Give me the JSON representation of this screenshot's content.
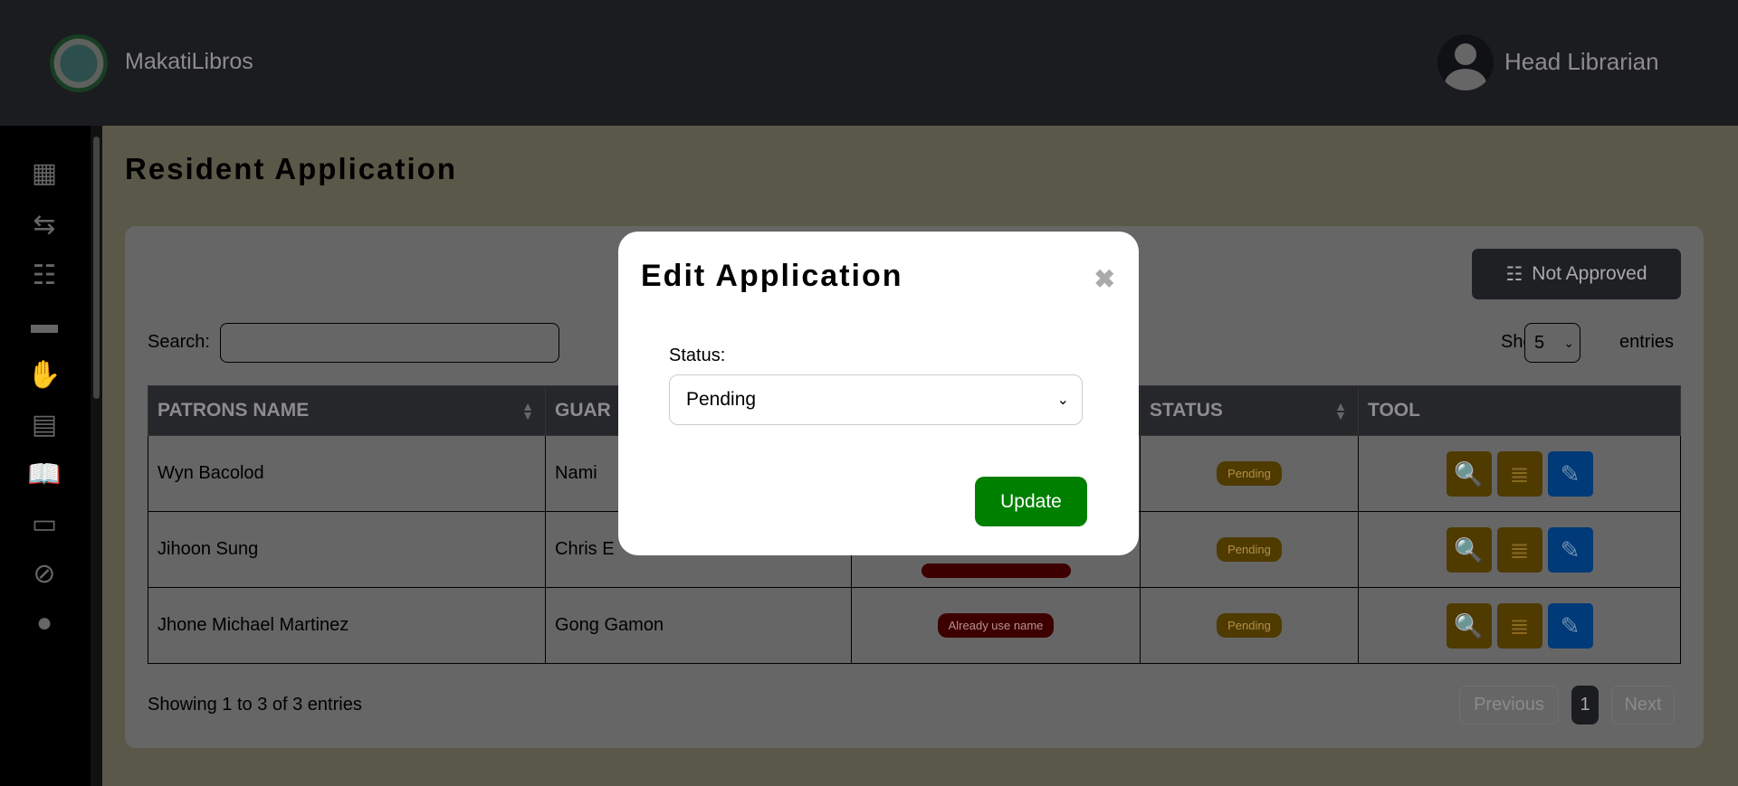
{
  "header": {
    "brand": "MakatiLibros",
    "logo_text": "MAKATI CITY LIBRARY 1954",
    "user": "Head Librarian"
  },
  "sidebar": {
    "items": [
      {
        "icon": "dashboard-icon"
      },
      {
        "icon": "transfer-icon"
      },
      {
        "icon": "list-check-icon"
      },
      {
        "icon": "book-icon"
      },
      {
        "icon": "hand-book-icon"
      },
      {
        "icon": "document-icon"
      },
      {
        "icon": "reader-icon"
      },
      {
        "icon": "id-card-check-icon"
      },
      {
        "icon": "user-blocked-icon"
      },
      {
        "icon": "user-icon"
      }
    ]
  },
  "page": {
    "title": "Resident Application"
  },
  "toolbar": {
    "not_approved": "Not Approved",
    "search_label": "Search:",
    "search_value": "",
    "show_label": "Show",
    "show_value": "5",
    "entries_label": "entries"
  },
  "table": {
    "columns": [
      "PATRONS NAME",
      "GUAR",
      "",
      "STATUS",
      "TOOL"
    ],
    "rows": [
      {
        "name": "Wyn Bacolod",
        "guardian": "Nami",
        "note": "",
        "status": "Pending"
      },
      {
        "name": "Jihoon Sung",
        "guardian": "Chris E",
        "note": "",
        "status": "Pending"
      },
      {
        "name": "Jhone Michael Martinez",
        "guardian": "Gong Gamon",
        "note": "Already use name",
        "status": "Pending"
      }
    ]
  },
  "footer": {
    "info": "Showing 1 to 3 of 3 entries",
    "previous": "Previous",
    "page": "1",
    "next": "Next"
  },
  "modal": {
    "title": "Edit Application",
    "close": "✖",
    "status_label": "Status:",
    "status_value": "Pending",
    "update": "Update"
  },
  "colors": {
    "pending": "#c59100",
    "used": "#9a0000",
    "edit": "#0d6efd",
    "update": "#008000"
  }
}
